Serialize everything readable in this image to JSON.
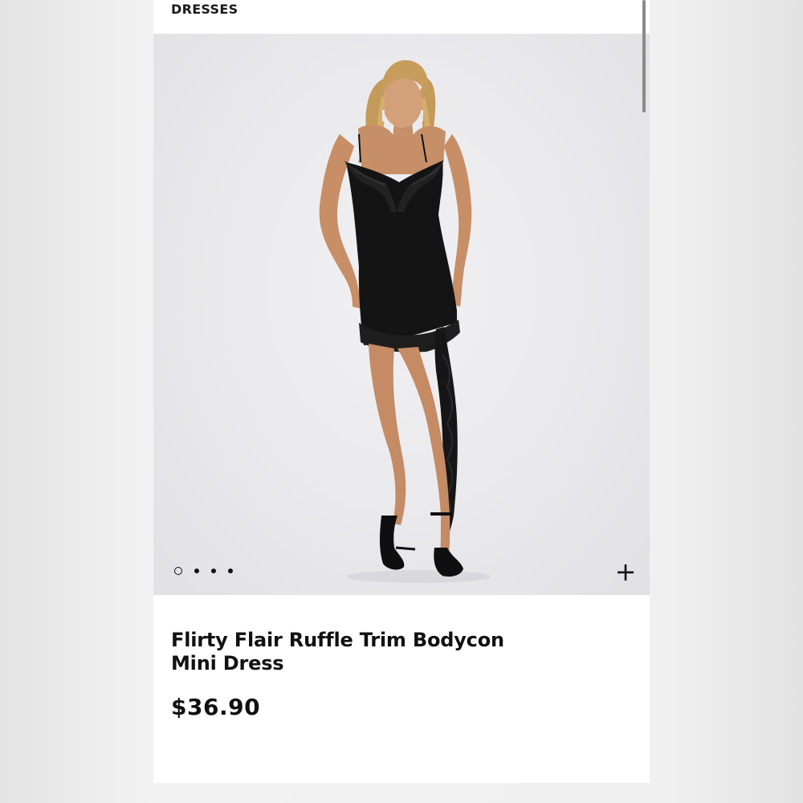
{
  "header": {
    "category": "DRESSES"
  },
  "gallery": {
    "image_alt": "Model wearing black ruffle trim bodycon mini dress",
    "image_count": 4,
    "active_index": 0,
    "add_icon": "plus-icon"
  },
  "product": {
    "name_line1": "Flirty Flair Ruffle Trim Bodycon",
    "name_line2": "Mini Dress",
    "price": "$36.90"
  },
  "colors": {
    "page_bg": "#ececec",
    "card_bg": "#ffffff",
    "text": "#111111",
    "dress": "#141414"
  }
}
